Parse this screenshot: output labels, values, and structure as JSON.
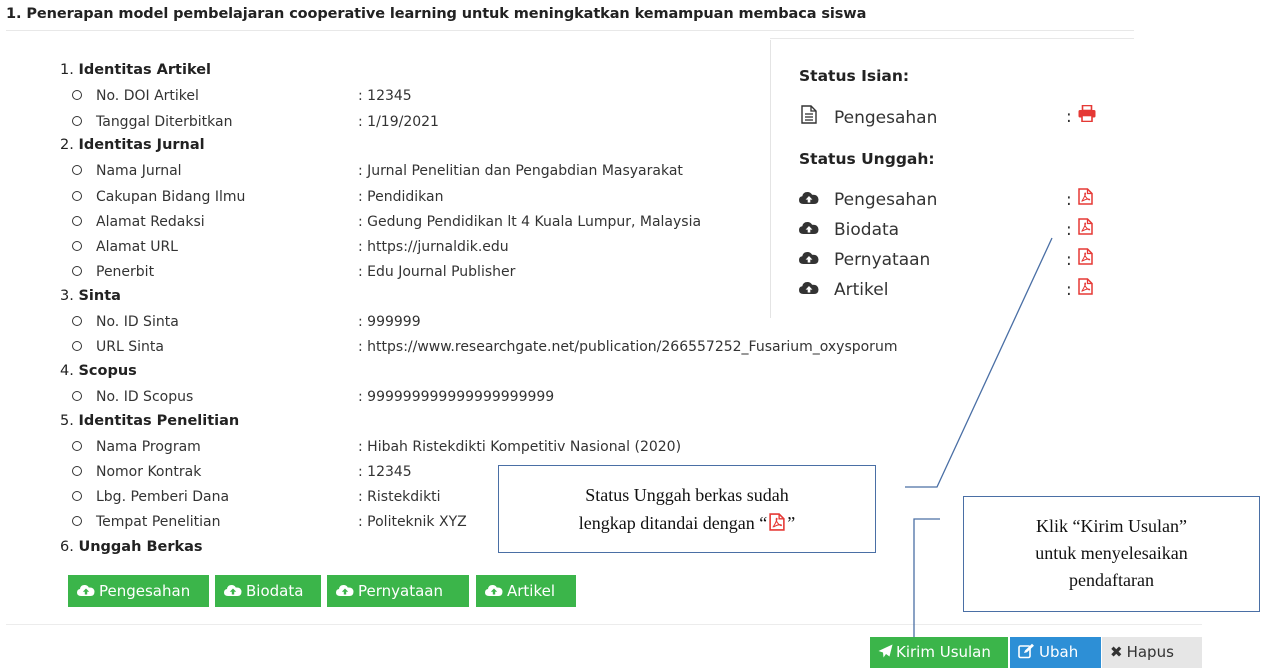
{
  "title": "1. Penerapan model pembelajaran cooperative learning untuk meningkatkan kemampuan membaca siswa",
  "sections": [
    {
      "num": "1.",
      "name": "Identitas Artikel",
      "items": [
        {
          "label": "No. DOI Artikel",
          "value": ": 12345"
        },
        {
          "label": "Tanggal Diterbitkan",
          "value": ": 1/19/2021"
        }
      ]
    },
    {
      "num": "2.",
      "name": "Identitas Jurnal",
      "items": [
        {
          "label": "Nama Jurnal",
          "value": ": Jurnal Penelitian dan Pengabdian Masyarakat"
        },
        {
          "label": "Cakupan Bidang Ilmu",
          "value": ": Pendidikan"
        },
        {
          "label": "Alamat Redaksi",
          "value": ": Gedung Pendidikan lt 4 Kuala Lumpur, Malaysia"
        },
        {
          "label": "Alamat URL",
          "value": ": https://jurnaldik.edu"
        },
        {
          "label": "Penerbit",
          "value": ": Edu Journal Publisher"
        }
      ]
    },
    {
      "num": "3.",
      "name": "Sinta",
      "items": [
        {
          "label": "No. ID Sinta",
          "value": ": 999999"
        },
        {
          "label": "URL Sinta",
          "value": ": https://www.researchgate.net/publication/266557252_Fusarium_oxysporum"
        }
      ]
    },
    {
      "num": "4.",
      "name": "Scopus",
      "items": [
        {
          "label": "No. ID Scopus",
          "value": ": 999999999999999999999"
        }
      ]
    },
    {
      "num": "5.",
      "name": "Identitas Penelitian",
      "items": [
        {
          "label": "Nama Program",
          "value": ": Hibah Ristekdikti Kompetitiv Nasional (2020)"
        },
        {
          "label": "Nomor Kontrak",
          "value": ": 12345"
        },
        {
          "label": "Lbg. Pemberi Dana",
          "value": ": Ristekdikti"
        },
        {
          "label": "Tempat Penelitian",
          "value": ": Politeknik XYZ"
        }
      ]
    },
    {
      "num": "6.",
      "name": "Unggah Berkas",
      "items": []
    }
  ],
  "upload_buttons": [
    "Pengesahan",
    "Biodata",
    "Pernyataan",
    "Artikel"
  ],
  "status_panel": {
    "isian_title": "Status Isian:",
    "isian_items": [
      {
        "label": "Pengesahan",
        "colon": ":"
      }
    ],
    "unggah_title": "Status Unggah:",
    "unggah_items": [
      {
        "label": "Pengesahan",
        "colon": ":"
      },
      {
        "label": "Biodata",
        "colon": ":"
      },
      {
        "label": "Pernyataan",
        "colon": ":"
      },
      {
        "label": "Artikel",
        "colon": ":"
      }
    ]
  },
  "actions": {
    "kirim": "Kirim Usulan",
    "ubah": "Ubah",
    "hapus": "Hapus"
  },
  "callouts": {
    "status_line1": "Status Unggah berkas sudah",
    "status_line2_prefix": "lengkap ditandai dengan “",
    "status_line2_suffix": "”",
    "kirim_line1": "Klik “Kirim Usulan”",
    "kirim_line2": "untuk menyelesaikan",
    "kirim_line3": "pendaftaran"
  },
  "colors": {
    "green": "#3bb54a",
    "blue": "#2d8fd6",
    "gray": "#e6e6e6",
    "pdf_red": "#e53935",
    "callout_border": "#4a6fa5"
  }
}
